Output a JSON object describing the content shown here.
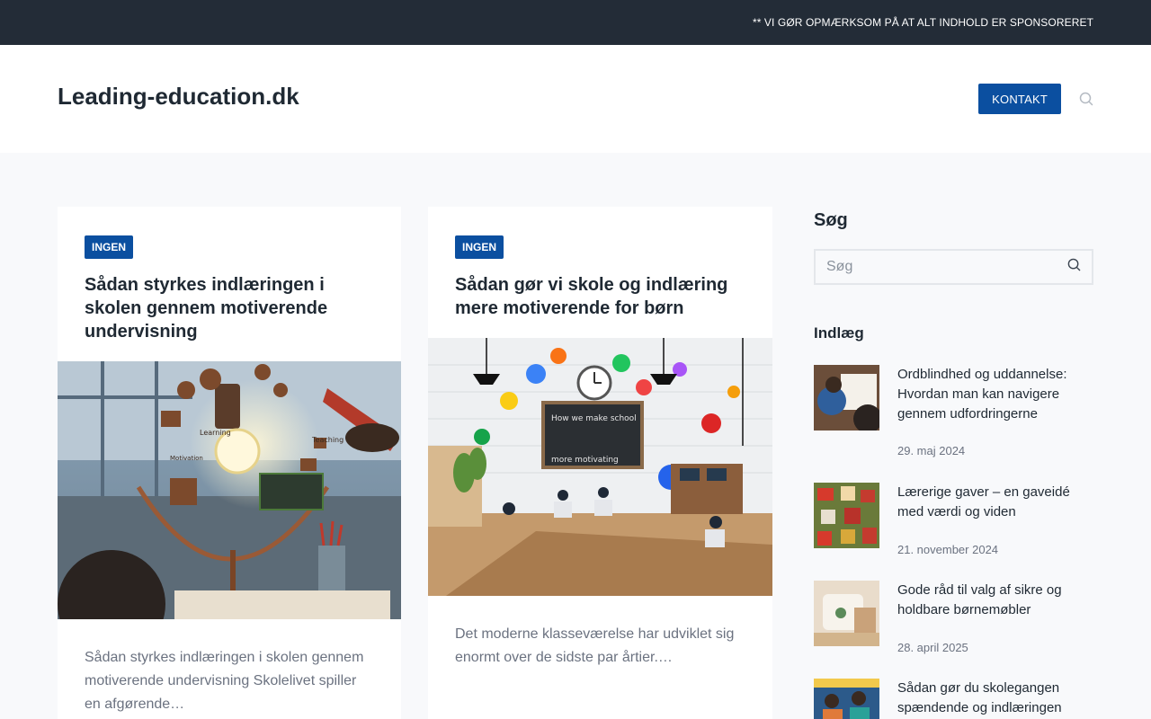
{
  "topbar": {
    "notice": "** VI GØR OPMÆRKSOM PÅ AT ALT INDHOLD ER SPONSORERET"
  },
  "header": {
    "site_title": "Leading-education.dk",
    "contact_label": "KONTAKT"
  },
  "articles": [
    {
      "category": "INGEN",
      "title": "Sådan styrkes indlæringen i skolen gennem motiverende undervisning",
      "excerpt": "Sådan styrkes indlæringen i skolen gennem motiverende undervisning Skolelivet spiller en afgørende…",
      "image_text": [
        "Learning",
        "Teaching",
        "Motivation"
      ]
    },
    {
      "category": "INGEN",
      "title": "Sådan gør vi skole og indlæring mere motiverende for børn",
      "excerpt": "Det moderne klasseværelse har udviklet sig enormt over de sidste par årtier.…",
      "image_text": [
        "How we make school",
        "more motivating"
      ]
    }
  ],
  "sidebar": {
    "search_heading": "Søg",
    "search_placeholder": "Søg",
    "posts_heading": "Indlæg",
    "posts": [
      {
        "title": "Ordblindhed og uddannelse: Hvordan man kan navigere gennem udfordringerne",
        "date": "29. maj 2024"
      },
      {
        "title": "Lærerige gaver – en gaveidé med værdi og viden",
        "date": "21. november 2024"
      },
      {
        "title": "Gode råd til valg af sikre og holdbare børnemøbler",
        "date": "28. april 2025"
      },
      {
        "title": "Sådan gør du skolegangen spændende og indlæringen",
        "date": ""
      }
    ]
  },
  "colors": {
    "accent": "#0b4fa0",
    "topbar": "#232c37",
    "background": "#f8f9fb"
  },
  "icons": {
    "search": "search-icon"
  }
}
